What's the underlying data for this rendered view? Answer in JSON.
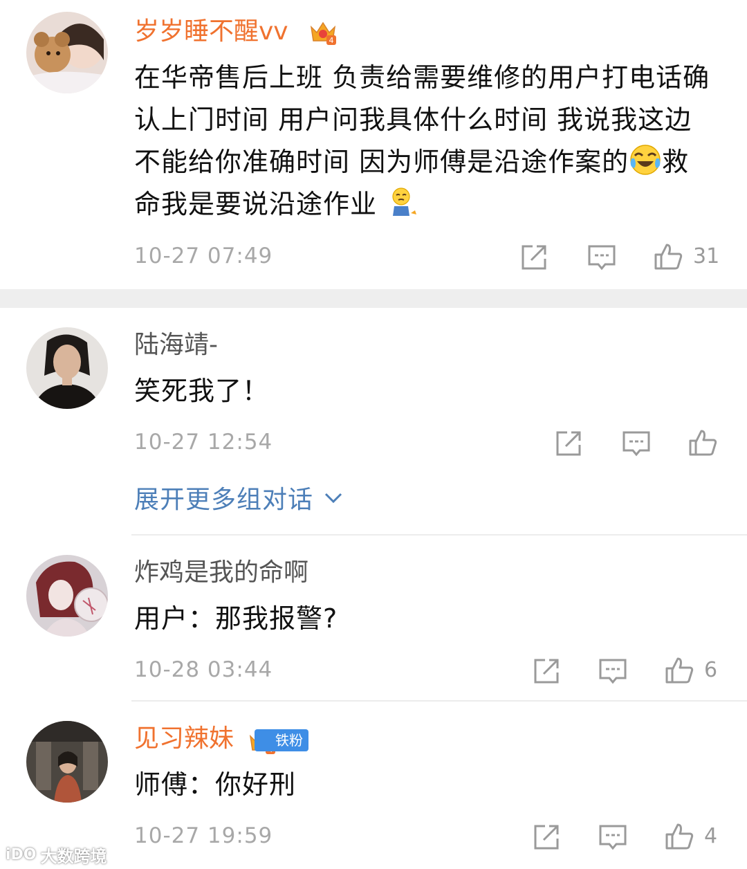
{
  "comments": [
    {
      "username": "岁岁睡不醒vv",
      "text_before_emoji": "在华帝售后上班 负责给需要维修的用户打电话确认上门时间 用户问我具体什么时间 我说我这边不能给你准确时间 因为师傅是沿途作案的",
      "emoji_1": "crying-laughing-emoji",
      "text_after_emoji": "救命我是要说沿途作业 ",
      "emoji_2": "kneeling-emoji",
      "time": "10-27 07:49",
      "likes": "31",
      "badge": "crown-level-badge"
    },
    {
      "username": "陆海靖-",
      "text": "笑死我了！",
      "time": "10-27 12:54",
      "likes": ""
    },
    {
      "username": "炸鸡是我的命啊",
      "text": "用户：那我报警?",
      "time": "10-28 03:44",
      "likes": "6"
    },
    {
      "username": "见习辣妹",
      "text": "师傅：你好刑",
      "time": "10-27 19:59",
      "likes": "4",
      "fan_badge": "铁粉"
    }
  ],
  "expand_link": "展开更多组对话",
  "watermark": {
    "logo": "iDO",
    "text": "大数跨境"
  },
  "colors": {
    "vip_name": "#f0722f",
    "link_blue": "#4d7fb8",
    "fan_badge": "#3e8ee6",
    "meta_gray": "#a8a8a8"
  },
  "icons": [
    "share-icon",
    "comment-icon",
    "like-icon",
    "chevron-down-icon",
    "crown-icon"
  ]
}
